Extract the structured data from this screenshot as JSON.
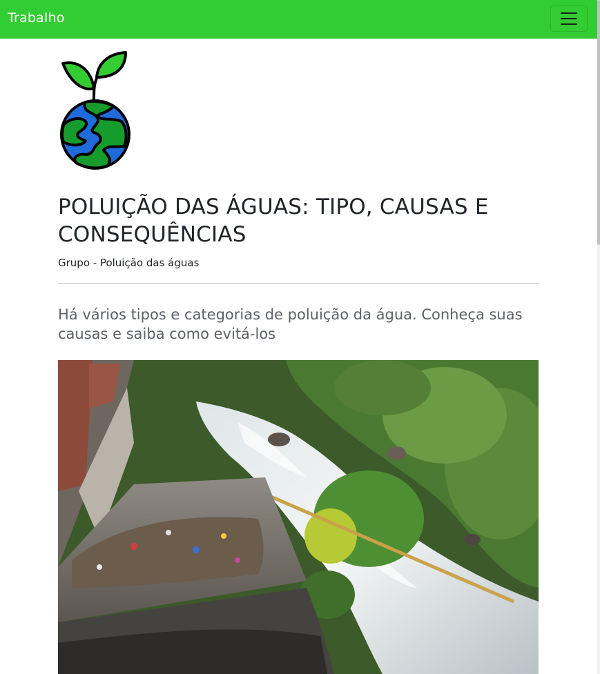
{
  "navbar": {
    "brand": "Trabalho",
    "menu_icon": "hamburger-menu-icon",
    "color": "#32cd32"
  },
  "logo": {
    "icon": "earth-with-sprout-icon"
  },
  "article": {
    "title": "POLUIÇÃO DAS ÁGUAS: TIPO, CAUSAS E CONSEQUÊNCIAS",
    "author": "Grupo - Poluição das águas",
    "subtitle": "Há vários tipos e categorias de poluição da água. Conheça suas causas e saiba como evitá-los"
  }
}
